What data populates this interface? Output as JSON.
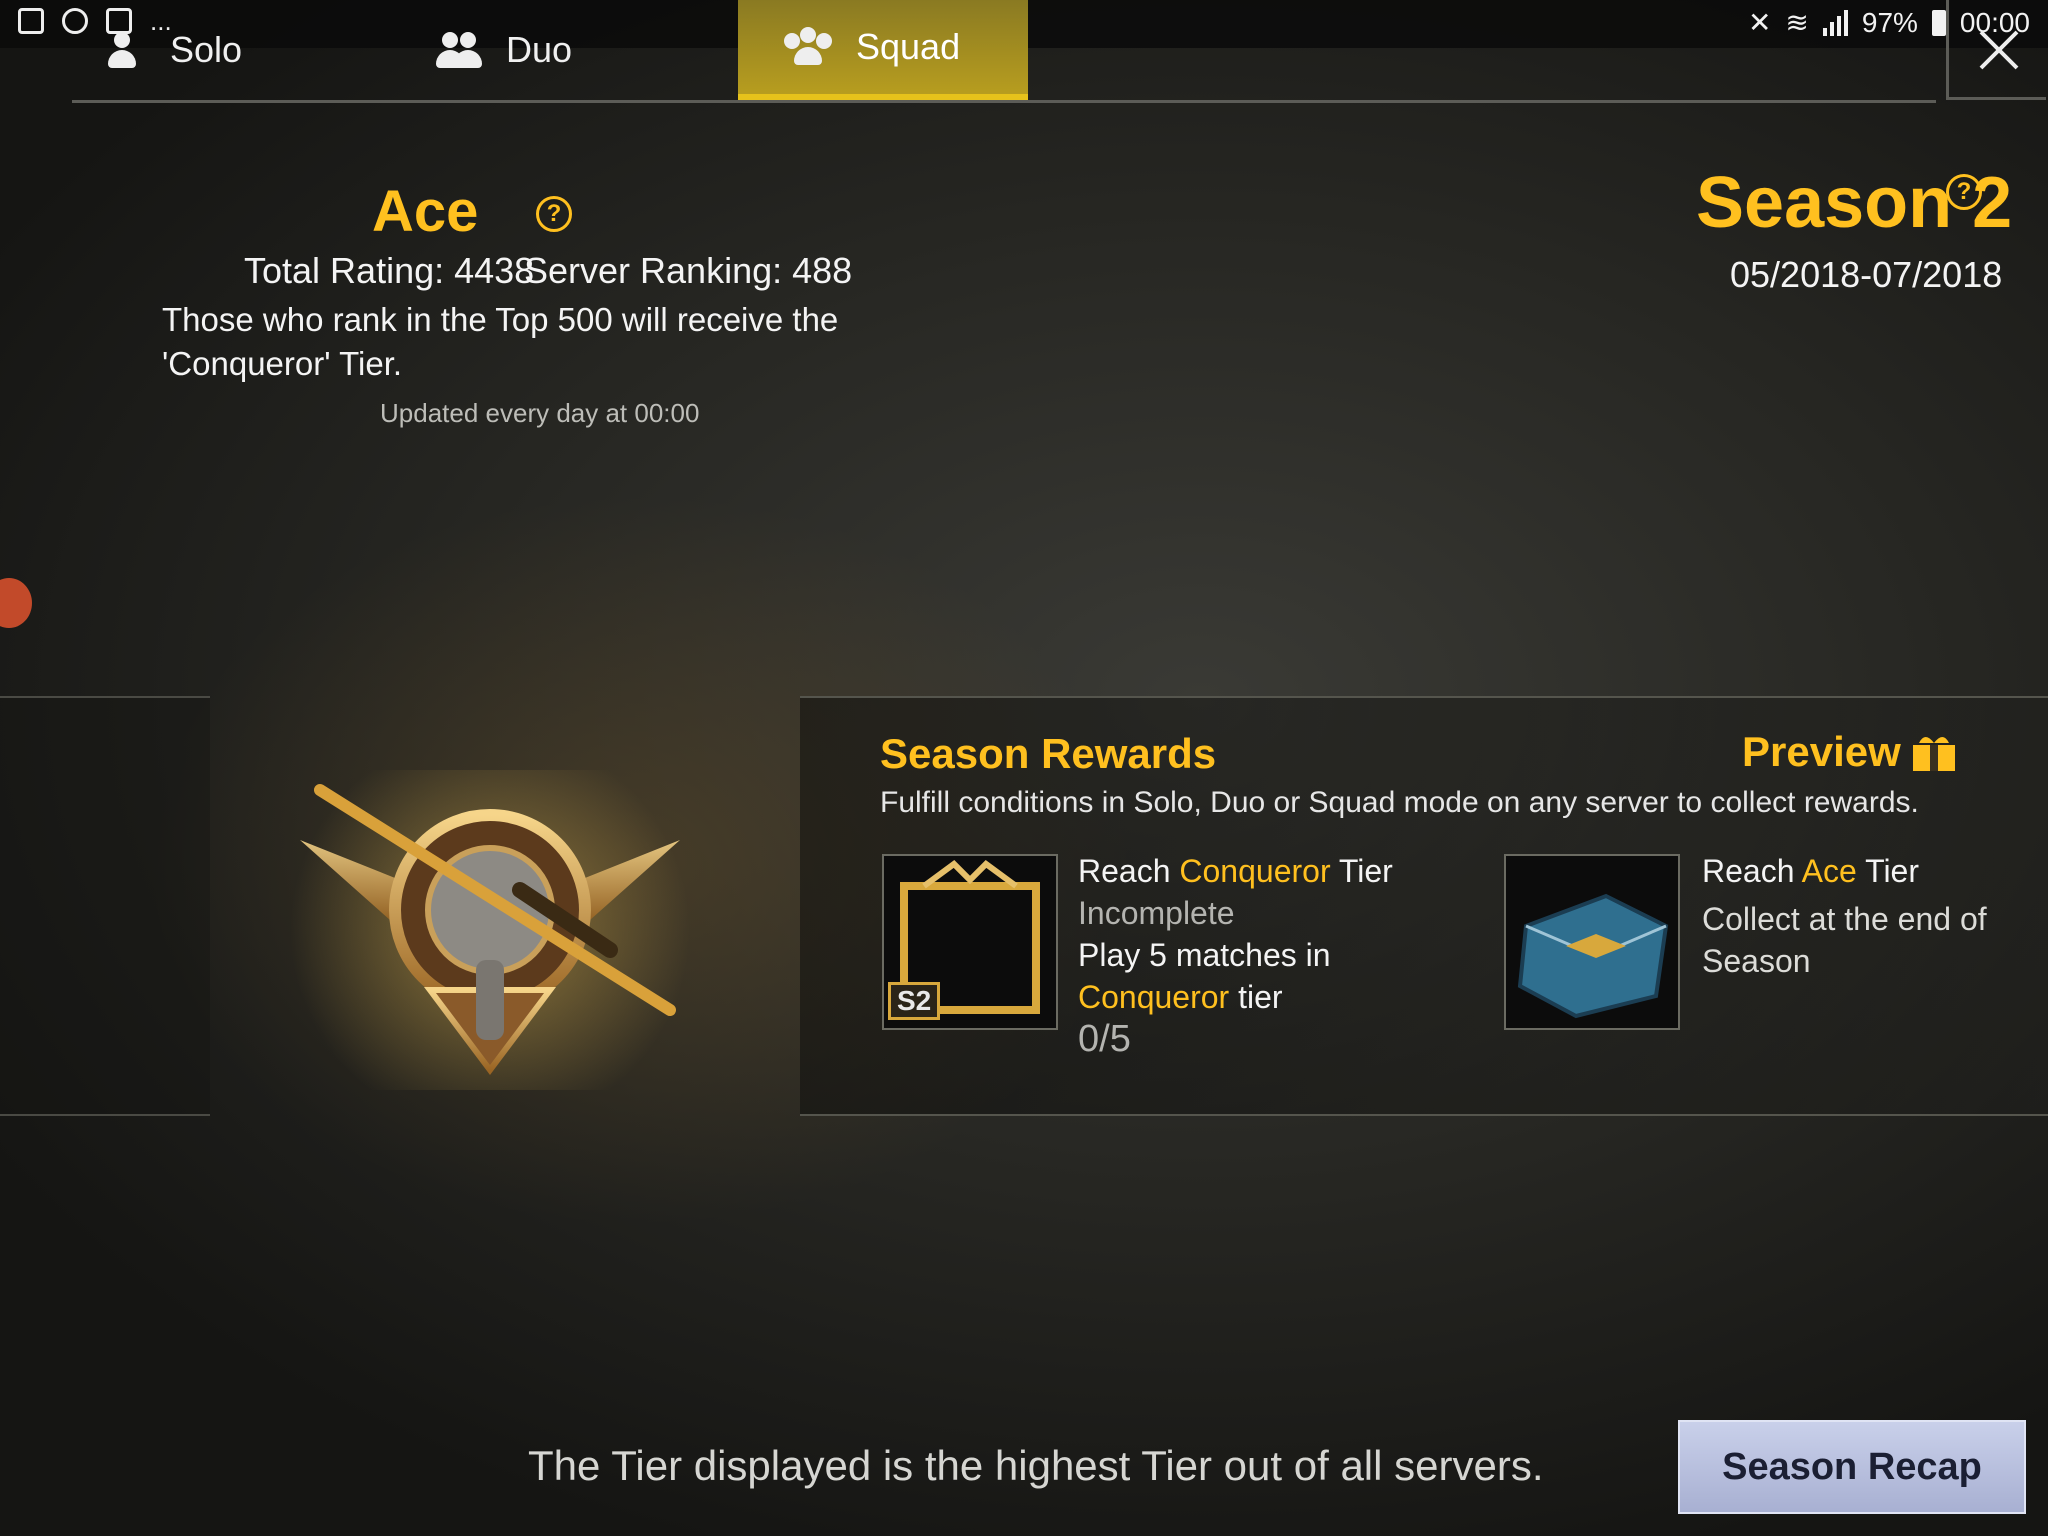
{
  "status_bar": {
    "left_icons": [
      "gallery-icon",
      "cloud-icon",
      "twitch-icon"
    ],
    "more": "...",
    "battery": "97%",
    "time": "00:00",
    "right_icons": [
      "mute-icon",
      "wifi-icon",
      "signal-icon",
      "battery-icon"
    ]
  },
  "tabs": [
    {
      "label": "Solo",
      "active": false,
      "icon": "solo-icon"
    },
    {
      "label": "Duo",
      "active": false,
      "icon": "duo-icon"
    },
    {
      "label": "Squad",
      "active": true,
      "icon": "squad-icon"
    }
  ],
  "tier": {
    "name": "Ace",
    "total_rating": "Total Rating: 4438",
    "server_ranking": "Server Ranking: 488",
    "conqueror_note": "Those who rank in the Top 500 will receive the 'Conqueror' Tier.",
    "update_note": "Updated every day at 00:00"
  },
  "season": {
    "title": "Season 2",
    "dates": "05/2018-07/2018"
  },
  "rewards": {
    "title": "Season Rewards",
    "preview_label": "Preview",
    "description": "Fulfill conditions in Solo, Duo or Squad mode on any server to collect rewards.",
    "items": [
      {
        "badge": "S2",
        "line1_prefix": "Reach ",
        "line1_highlight": "Conqueror",
        "line1_suffix": " Tier",
        "status": "Incomplete",
        "req_line1": "Play 5 matches in",
        "req_highlight": "Conqueror",
        "req_suffix": " tier",
        "progress": "0/5"
      },
      {
        "line1_prefix": "Reach ",
        "line1_highlight": "Ace",
        "line1_suffix": " Tier",
        "status": "Collect at the end of Season"
      }
    ]
  },
  "footer_note": "The Tier displayed is the highest Tier out of all servers.",
  "season_recap_label": "Season Recap",
  "colors": {
    "accent": "#ffc01f",
    "tab_active": "#b79d1f",
    "button": "#b8bfdf"
  }
}
